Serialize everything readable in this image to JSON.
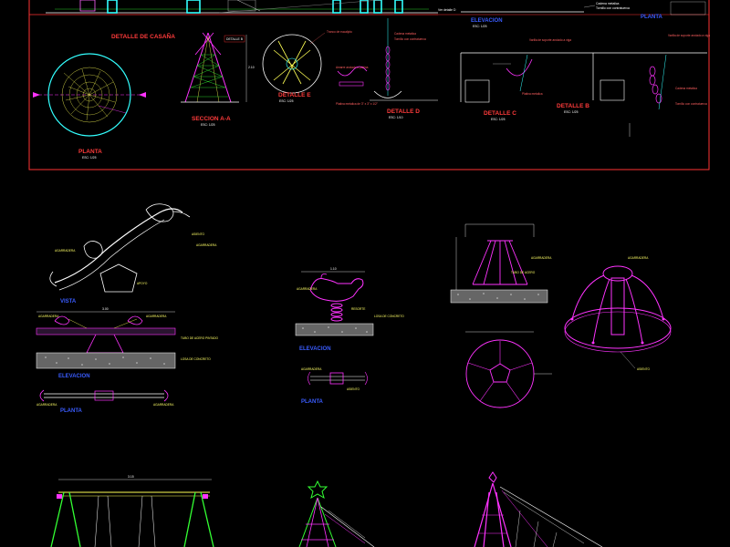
{
  "colors": {
    "background": "#000000",
    "frame": "#ff3333",
    "magenta": "#ff33ff",
    "cyan": "#33ffff",
    "yellow": "#ffff55",
    "green": "#33ff33",
    "white": "#ffffff",
    "blue": "#3355ff",
    "gray": "#b0b0b0"
  },
  "top_sheet": {
    "elevacion": {
      "title": "ELEVACION",
      "scale": "ESC: 1/25"
    },
    "planta_top": {
      "title": "PLANTA"
    },
    "detalle_casana": {
      "title": "DETALLE DE CASAÑA"
    },
    "planta": {
      "title": "PLANTA",
      "scale": "ESC: 1/25"
    },
    "seccion_aa": {
      "title": "SECCION A-A",
      "scale": "ESC: 1/25"
    },
    "detalle_e": {
      "title": "DETALLE E",
      "scale": "ESC: 1/25"
    },
    "detalle_d": {
      "title": "DETALLE D",
      "scale": "ESC: 1/10"
    },
    "detalle_c": {
      "title": "DETALLE C",
      "scale": "ESC: 1/25"
    },
    "detalle_b": {
      "title": "DETALLE B",
      "scale": "ESC: 1/25"
    },
    "detalle_b_callout": "DETALLE B",
    "notes": [
      "Cadena metalica",
      "Tornillo con contratuerca",
      "Ver detalle D",
      "Tronco de eucalipto",
      "Amarre anclado a platina",
      "Platina metalica de 3\" x 3\" x 1/2\"",
      "Varilla de soporte anclado a viga",
      "Platina metalica",
      "Cadena metalica",
      "Tornillo con contratuerca"
    ]
  },
  "sheet2": {
    "subibaja": {
      "vista": "VISTA",
      "elevacion": "ELEVACION",
      "planta": "PLANTA"
    },
    "resorte": {
      "elevacion": "ELEVACION",
      "planta": "PLANTA"
    }
  }
}
